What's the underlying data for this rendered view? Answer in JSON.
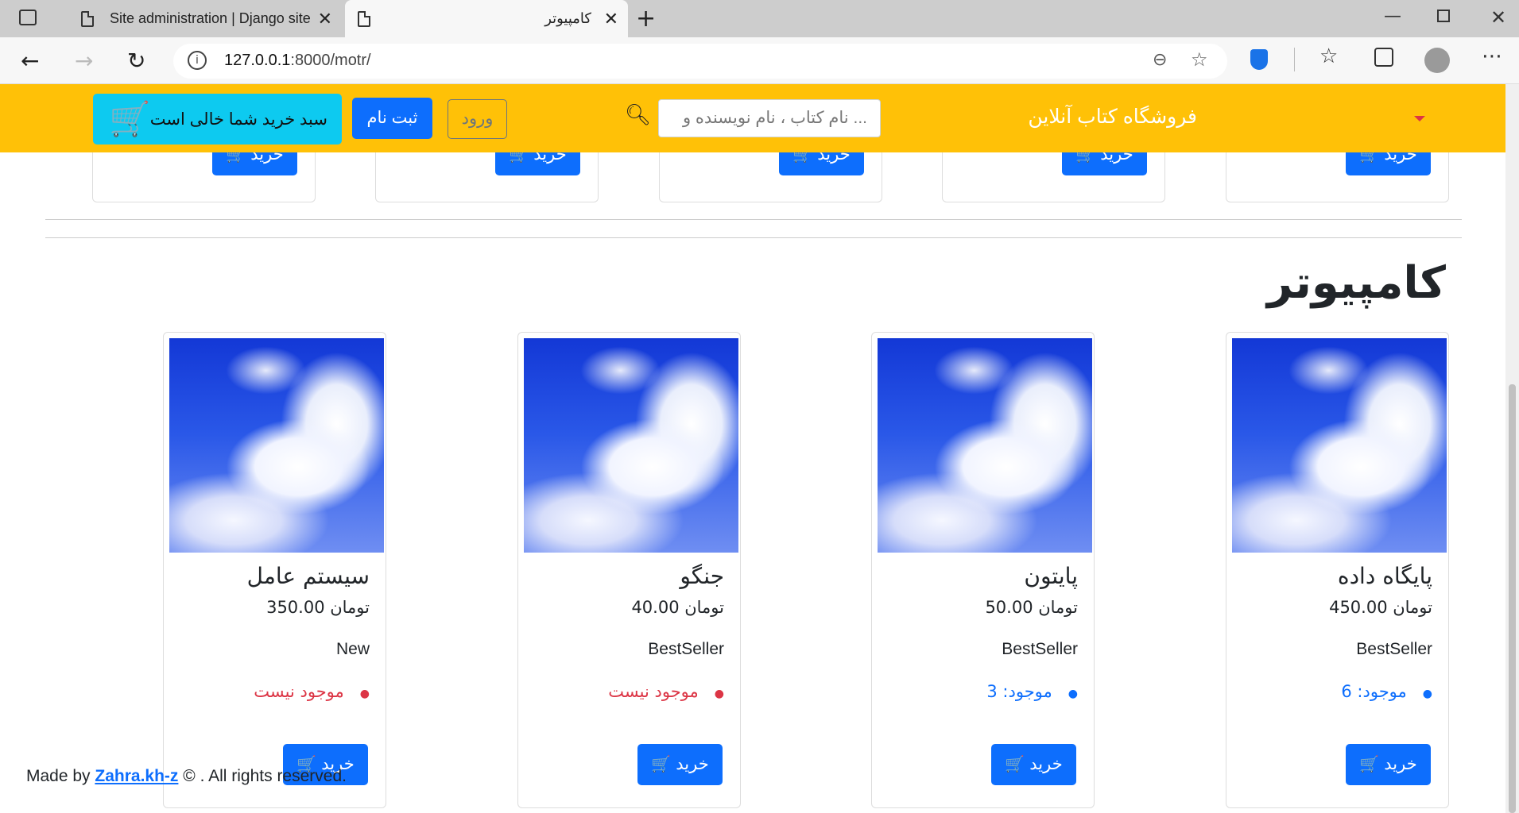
{
  "browser": {
    "tabs": [
      {
        "title": "Site administration | Django site",
        "active": false
      },
      {
        "title": "کامپیوتر",
        "active": true
      }
    ],
    "new_tab": "+",
    "url_host": "127.0.0.1",
    "url_rest": ":8000/motr/",
    "window_controls": [
      "minimize",
      "restore",
      "close"
    ]
  },
  "navbar": {
    "brand": "فروشگاه کتاب آنلاین",
    "search_placeholder": "نام کتاب ، نام نویسنده و ...",
    "login": "ورود",
    "signup": "ثبت نام",
    "cart": "سبد خرید شما خالی است",
    "accent": "#ffc107"
  },
  "top_buy_buttons": [
    "خرید",
    "خرید",
    "خرید",
    "خرید",
    "خرید"
  ],
  "section": {
    "title": "کامپیوتر",
    "products": [
      {
        "name": "پایگاه داده",
        "price": "450.00 تومان",
        "tag": "BestSeller",
        "stock": "موجود: 6",
        "in_stock": true,
        "buy": "خرید"
      },
      {
        "name": "پایتون",
        "price": "50.00 تومان",
        "tag": "BestSeller",
        "stock": "موجود: 3",
        "in_stock": true,
        "buy": "خرید"
      },
      {
        "name": "جنگو",
        "price": "40.00 تومان",
        "tag": "BestSeller",
        "stock": "موجود نیست",
        "in_stock": false,
        "buy": "خرید"
      },
      {
        "name": "سیستم عامل",
        "price": "350.00 تومان",
        "tag": "New",
        "stock": "موجود نیست",
        "in_stock": false,
        "buy": "خرید"
      }
    ]
  },
  "footer": {
    "prefix": "Made by",
    "author": "Zahra.kh-z",
    "suffix": "© . All rights reserved."
  }
}
